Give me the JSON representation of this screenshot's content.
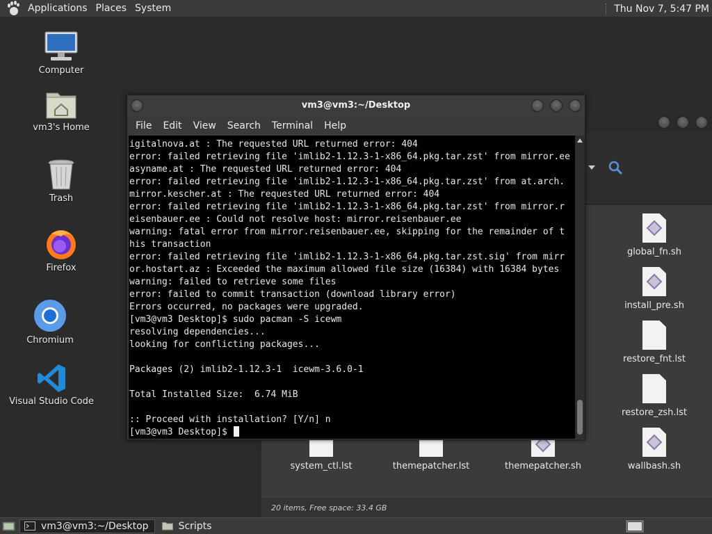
{
  "top_panel": {
    "menus": [
      "Applications",
      "Places",
      "System"
    ],
    "clock": "Thu Nov 7, 5:47 PM"
  },
  "desktop": {
    "icons": [
      {
        "label": "Computer",
        "icon": "computer-icon"
      },
      {
        "label": "vm3's Home",
        "icon": "home-folder-icon"
      },
      {
        "label": "Trash",
        "icon": "trash-icon"
      },
      {
        "label": "Firefox",
        "icon": "firefox-icon"
      },
      {
        "label": "Chromium",
        "icon": "chromium-icon"
      },
      {
        "label": "Visual Studio Code",
        "icon": "vscode-icon"
      }
    ]
  },
  "terminal": {
    "title": "vm3@vm3:~/Desktop",
    "menus": [
      "File",
      "Edit",
      "View",
      "Search",
      "Terminal",
      "Help"
    ],
    "lines": [
      "igitalnova.at : The requested URL returned error: 404",
      "error: failed retrieving file 'imlib2-1.12.3-1-x86_64.pkg.tar.zst' from mirror.ee",
      "asyname.at : The requested URL returned error: 404",
      "error: failed retrieving file 'imlib2-1.12.3-1-x86_64.pkg.tar.zst' from at.arch.",
      "mirror.kescher.at : The requested URL returned error: 404",
      "error: failed retrieving file 'imlib2-1.12.3-1-x86_64.pkg.tar.zst' from mirror.r",
      "eisenbauer.ee : Could not resolve host: mirror.reisenbauer.ee",
      "warning: fatal error from mirror.reisenbauer.ee, skipping for the remainder of t",
      "his transaction",
      "error: failed retrieving file 'imlib2-1.12.3-1-x86_64.pkg.tar.zst.sig' from mirr",
      "or.hostart.az : Exceeded the maximum allowed file size (16384) with 16384 bytes",
      "warning: failed to retrieve some files",
      "error: failed to commit transaction (download library error)",
      "Errors occurred, no packages were upgraded.",
      "[vm3@vm3 Desktop]$ sudo pacman -S icewm",
      "resolving dependencies...",
      "looking for conflicting packages...",
      "",
      "Packages (2) imlib2-1.12.3-1  icewm-3.6.0-1",
      "",
      "Total Installed Size:  6.74 MiB",
      "",
      ":: Proceed with installation? [Y/n] n"
    ],
    "prompt": "[vm3@vm3 Desktop]$ "
  },
  "file_manager": {
    "files": [
      {
        "name": "global_fn.sh",
        "type": "script"
      },
      {
        "name": "install_pre.sh",
        "type": "script"
      },
      {
        "name": "restore_fnt.lst",
        "type": "text"
      },
      {
        "name": "restore_zsh.lst",
        "type": "text"
      },
      {
        "name": "system_ctl.lst",
        "type": "text"
      },
      {
        "name": "themepatcher.lst",
        "type": "text"
      },
      {
        "name": "themepatcher.sh",
        "type": "script"
      },
      {
        "name": "wallbash.sh",
        "type": "script"
      }
    ],
    "status": "20 items, Free space: 33.4 GB"
  },
  "taskbar": {
    "tasks": [
      {
        "label": "vm3@vm3:~/Desktop",
        "icon": "terminal-icon"
      },
      {
        "label": "Scripts",
        "icon": "folder-icon"
      }
    ]
  }
}
